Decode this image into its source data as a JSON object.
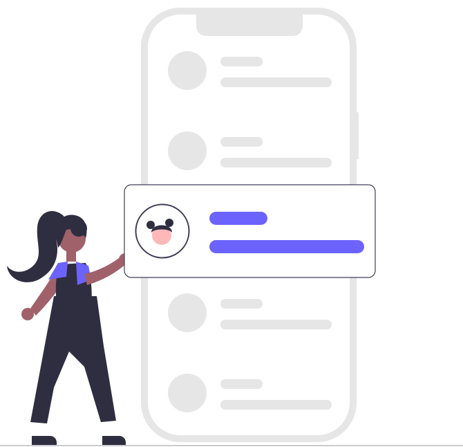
{
  "illustration": {
    "subject": "person-selecting-contact-card",
    "colors": {
      "background": "#ffffff",
      "phone_outline": "#e6e6e6",
      "placeholder": "#e6e6e6",
      "card_border": "#3f3d56",
      "card_fill": "#ffffff",
      "accent": "#6c63ff",
      "dark": "#2f2e41",
      "skin": "#a0616a",
      "face": "#ffb8b8",
      "shirt": "#6c63ff",
      "ground": "#cccccc"
    },
    "icons": {
      "avatar": "woman-avatar-icon",
      "person": "standing-woman-figure"
    },
    "list": {
      "rows_above_card": 2,
      "rows_below_card": 2,
      "selected_row": 3
    }
  }
}
